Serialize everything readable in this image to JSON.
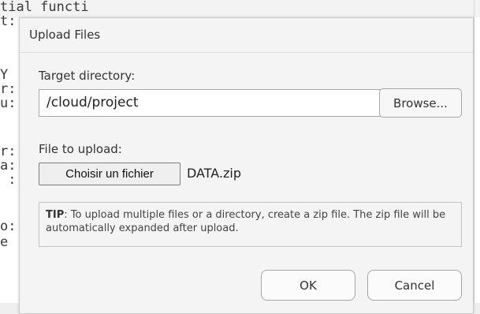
{
  "background": {
    "code_lines": [
      "t:",
      "",
      "",
      "",
      "Y",
      "r:",
      "u:",
      "",
      "r:",
      "a:",
      " :",
      "",
      "o:",
      "e"
    ],
    "top_fragment": "tial functi"
  },
  "dialog": {
    "title": "Upload Files",
    "target_label": "Target directory:",
    "target_value": "/cloud/project",
    "browse_label": "Browse...",
    "file_label": "File to upload:",
    "choose_file_label": "Choisir un fichier",
    "file_name": "DATA.zip",
    "tip_prefix": "TIP",
    "tip_text": ": To upload multiple files or a directory, create a zip file. The zip file will be automatically expanded after upload.",
    "ok_label": "OK",
    "cancel_label": "Cancel"
  }
}
